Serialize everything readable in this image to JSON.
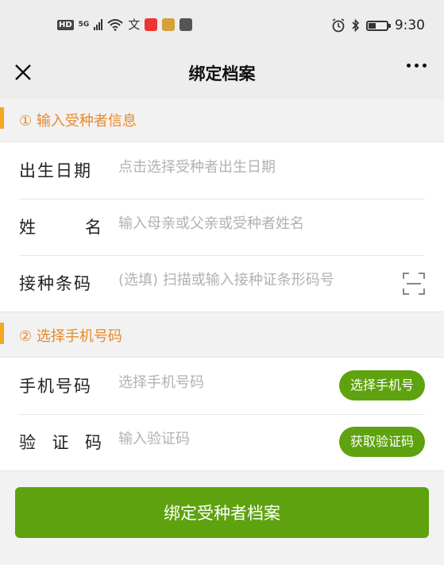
{
  "status_bar": {
    "hd": "HD",
    "network": "5G",
    "time": "9:30",
    "icons": [
      "hd-icon",
      "signal-icon",
      "wifi-icon",
      "translate-icon",
      "app-icon",
      "app-icon",
      "app-icon",
      "alarm-icon",
      "bluetooth-icon",
      "battery-icon"
    ]
  },
  "navbar": {
    "title": "绑定档案",
    "icons": [
      "close-icon",
      "more-icon"
    ]
  },
  "section_1": {
    "title": "① 输入受种者信息",
    "rows": [
      {
        "label": "出生日期",
        "placeholder": "点击选择受种者出生日期"
      },
      {
        "label_chars": [
          "姓",
          "名"
        ],
        "placeholder": "输入母亲或父亲或受种者姓名"
      },
      {
        "label": "接种条码",
        "placeholder": "(选填) 扫描或输入接种证条形码号",
        "icon": "scan-icon"
      }
    ]
  },
  "section_2": {
    "title": "② 选择手机号码",
    "rows": [
      {
        "label": "手机号码",
        "placeholder": "选择手机号码",
        "button": "选择手机号"
      },
      {
        "label_chars": [
          "验",
          "证",
          "码"
        ],
        "placeholder": "输入验证码",
        "button": "获取验证码"
      }
    ]
  },
  "submit_label": "绑定受种者档案",
  "colors": {
    "accent_green": "#5ea20f",
    "section_orange": "#e8892a",
    "section_bar": "#f5a623",
    "background": "#f2f2f2"
  }
}
